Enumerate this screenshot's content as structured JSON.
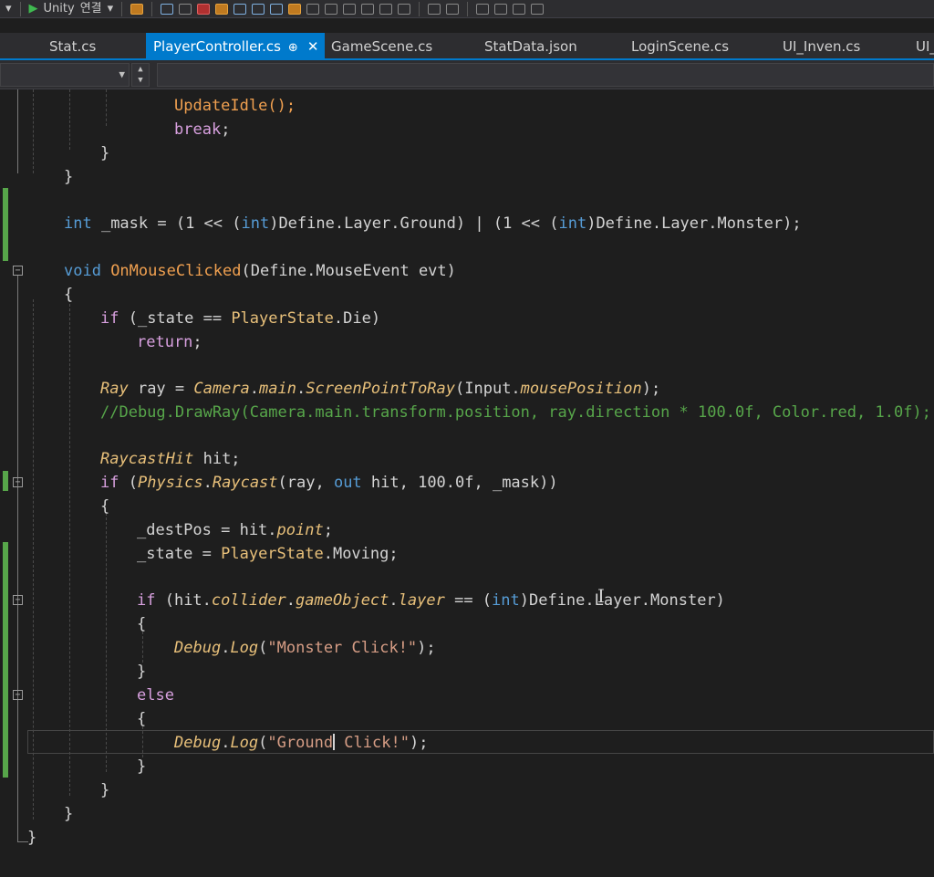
{
  "toolbar": {
    "config_label": "Unity",
    "attach_label": "연결"
  },
  "tabs": [
    {
      "label": "Stat.cs"
    },
    {
      "label": "PlayerController.cs",
      "pin": "⊕",
      "close": "✕"
    },
    {
      "label": "GameScene.cs"
    },
    {
      "label": "StatData.json"
    },
    {
      "label": "LoginScene.cs"
    },
    {
      "label": "UI_Inven.cs"
    },
    {
      "label": "UI_"
    }
  ],
  "colors": {
    "accent": "#007acc",
    "keyword": "#569cd6",
    "type": "#4ec9b0",
    "comment": "#57a64a",
    "string": "#d69d85"
  },
  "code": {
    "l1": "UpdateIdle();",
    "l2_kw": "break",
    "l2_p": ";",
    "brace_close": "}",
    "brace_open": "{",
    "l5_kw": "int",
    "l5_a": " _mask = (1 << (",
    "l5_kw2": "int",
    "l5_b": ")Define.Layer.Ground) | (1 << (",
    "l5_kw3": "int",
    "l5_c": ")Define.Layer.Monster);",
    "l6_kw": "void",
    "l6_fn": " OnMouseClicked",
    "l6_rest": "(Define.MouseEvent evt)",
    "l8_kw": "if",
    "l8_a": " (_state == ",
    "l8_ty": "PlayerState",
    "l8_b": ".Die)",
    "l9_kw": "return",
    "l9_p": ";",
    "l10_ty": "Ray",
    "l10_a": " ray = ",
    "l10_cam": "Camera",
    "l10_b": ".",
    "l10_main": "main",
    "l10_c": ".",
    "l10_fn": "ScreenPointToRay",
    "l10_d": "(Input.",
    "l10_mp": "mousePosition",
    "l10_e": ");",
    "l11_cm": "//Debug.DrawRay(Camera.main.transform.position, ray.direction * 100.0f, Color.red, 1.0f);",
    "l12_ty": "RaycastHit",
    "l12_a": " hit;",
    "l13_kw": "if",
    "l13_a": " (",
    "l13_ph": "Physics",
    "l13_b": ".",
    "l13_fn": "Raycast",
    "l13_c": "(ray, ",
    "l13_out": "out",
    "l13_d": " hit, 100.0f, _mask))",
    "l15_a": "_destPos = hit.",
    "l15_pt": "point",
    "l15_b": ";",
    "l16_a": "_state = ",
    "l16_ty": "PlayerState",
    "l16_b": ".Moving;",
    "l17_kw": "if",
    "l17_a": " (hit.",
    "l17_col": "collider",
    "l17_b": ".",
    "l17_go": "gameObject",
    "l17_c": ".",
    "l17_ly": "layer",
    "l17_d": " == (",
    "l17_kw2": "int",
    "l17_e": ")Define.Layer.Monster)",
    "l19_dbg": "Debug",
    "l19_a": ".",
    "l19_log": "Log",
    "l19_b": "(",
    "l19_str": "\"Monster Click!\"",
    "l19_c": ");",
    "l21_kw": "else",
    "l23_dbg": "Debug",
    "l23_a": ".",
    "l23_log": "Log",
    "l23_b": "(",
    "l23_str1": "\"Ground",
    "l23_str2": " Click!\"",
    "l23_c": ");"
  }
}
